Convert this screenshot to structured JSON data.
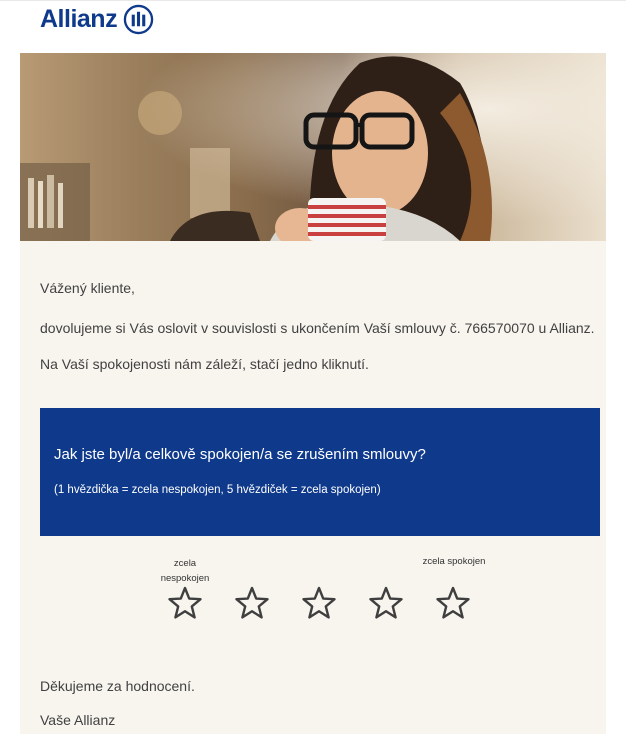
{
  "brand": {
    "name": "Allianz",
    "logo_icon": "allianz-eagle-icon",
    "color": "#0f3a8c"
  },
  "hero": {
    "image": "woman-with-glasses-holding-striped-mug"
  },
  "email": {
    "greeting": "Vážený kliente,",
    "paragraph1": "dovolujeme si Vás oslovit v souvislosti s ukončením Vaší smlouvy č. 766570070 u Allianz.",
    "paragraph2": "Na Vaší spokojenosti nám záleží, stačí jedno kliknutí."
  },
  "survey": {
    "question": "Jak jste byl/a celkově spokojen/a se zrušením smlouvy?",
    "hint": "(1 hvězdička = zcela nespokojen, 5 hvězdiček = zcela spokojen)",
    "label_low_line1": "zcela",
    "label_low_line2": "nespokojen",
    "label_high": "zcela spokojen",
    "star_count": 5,
    "box_color": "#0f3a8c"
  },
  "closing": {
    "thanks": "Děkujeme za hodnocení.",
    "signature": "Vaše Allianz"
  }
}
